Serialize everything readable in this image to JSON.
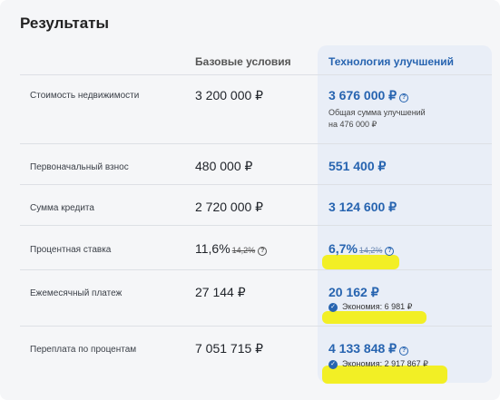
{
  "title": "Результаты",
  "columns": {
    "base": "Базовые условия",
    "tech": "Технология улучшений"
  },
  "rows": [
    {
      "label": "Стоимость недвижимости",
      "base": "3 200 000 ₽",
      "tech": "3 676 000 ₽",
      "tech_note_1": "Общая сумма улучшений",
      "tech_note_2": "на 476 000 ₽"
    },
    {
      "label": "Первоначальный взнос",
      "base": "480 000 ₽",
      "tech": "551 400 ₽"
    },
    {
      "label": "Сумма кредита",
      "base": "2 720 000 ₽",
      "tech": "3 124 600 ₽"
    },
    {
      "label": "Процентная ставка",
      "base": "11,6%",
      "base_old": "14,2%",
      "tech": "6,7%",
      "tech_old": "14,2%"
    },
    {
      "label": "Ежемесячный платеж",
      "base": "27 144 ₽",
      "tech": "20 162 ₽",
      "saving": "Экономия: 6 981 ₽"
    },
    {
      "label": "Переплата по процентам",
      "base": "7 051 715 ₽",
      "tech": "4 133 848 ₽",
      "saving": "Экономия: 2 917 867 ₽"
    }
  ],
  "icons": {
    "help": "?",
    "check": "✓"
  },
  "colors": {
    "accent": "#2764b0",
    "highlight": "#f2ef12",
    "background": "#f5f6f8"
  }
}
